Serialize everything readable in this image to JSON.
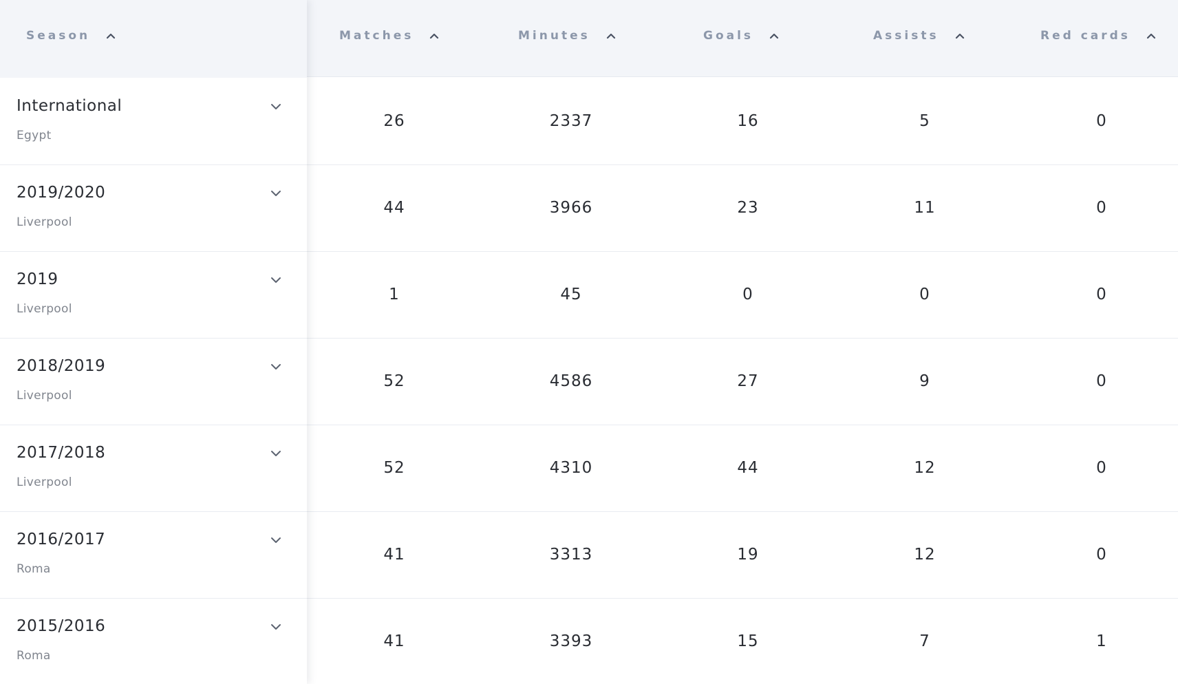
{
  "columns": {
    "season": "Season",
    "matches": "Matches",
    "minutes": "Minutes",
    "goals": "Goals",
    "assists": "Assists",
    "red_cards": "Red cards"
  },
  "icons": {
    "sort": "chevron-up-icon",
    "expand": "chevron-down-icon"
  },
  "colors": {
    "header_bg": "#f3f5f9",
    "header_text": "#8c97aa",
    "body_text": "#2a2d33",
    "sub_text": "#80858e",
    "divider": "#e9ecf1"
  },
  "rows": [
    {
      "season": "International",
      "club": "Egypt",
      "matches": "26",
      "minutes": "2337",
      "goals": "16",
      "assists": "5",
      "red_cards": "0"
    },
    {
      "season": "2019/2020",
      "club": "Liverpool",
      "matches": "44",
      "minutes": "3966",
      "goals": "23",
      "assists": "11",
      "red_cards": "0"
    },
    {
      "season": "2019",
      "club": "Liverpool",
      "matches": "1",
      "minutes": "45",
      "goals": "0",
      "assists": "0",
      "red_cards": "0"
    },
    {
      "season": "2018/2019",
      "club": "Liverpool",
      "matches": "52",
      "minutes": "4586",
      "goals": "27",
      "assists": "9",
      "red_cards": "0"
    },
    {
      "season": "2017/2018",
      "club": "Liverpool",
      "matches": "52",
      "minutes": "4310",
      "goals": "44",
      "assists": "12",
      "red_cards": "0"
    },
    {
      "season": "2016/2017",
      "club": "Roma",
      "matches": "41",
      "minutes": "3313",
      "goals": "19",
      "assists": "12",
      "red_cards": "0"
    },
    {
      "season": "2015/2016",
      "club": "Roma",
      "matches": "41",
      "minutes": "3393",
      "goals": "15",
      "assists": "7",
      "red_cards": "1"
    }
  ]
}
